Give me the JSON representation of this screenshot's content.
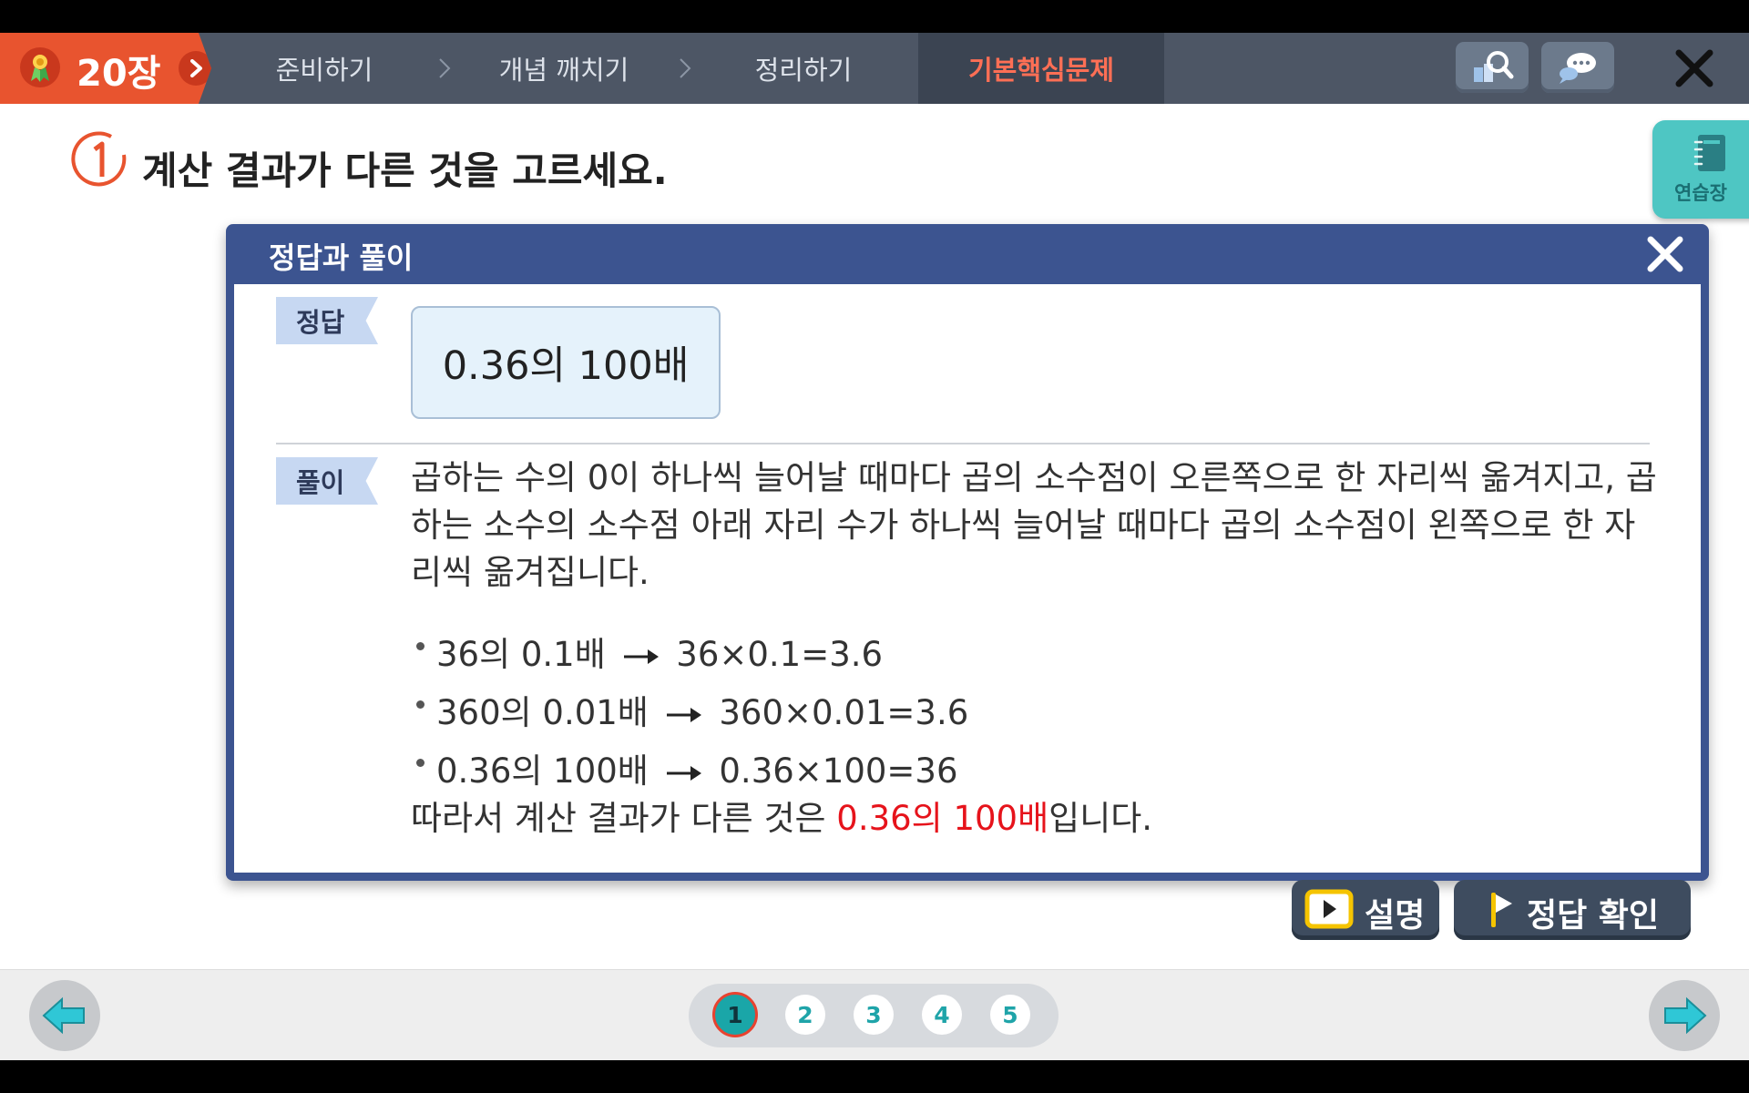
{
  "header": {
    "chapter": "20장",
    "steps": [
      {
        "label": "준비하기"
      },
      {
        "label": "개념 깨치기"
      },
      {
        "label": "정리하기"
      },
      {
        "label": "기본핵심문제"
      }
    ],
    "tools": [
      "search-book-icon",
      "chat-icon"
    ],
    "close_icon": "close-icon"
  },
  "question": {
    "number": "1",
    "text": "계산 결과가 다른 것을 고르세요."
  },
  "notebook": {
    "label": "연습장"
  },
  "modal": {
    "title": "정답과 풀이",
    "answer_tag": "정답",
    "answer": "0.36의 100배",
    "solution_tag": "풀이",
    "solution_text": "곱하는 수의 0이 하나씩 늘어날 때마다 곱의 소수점이 오른쪽으로 한 자리씩 옮겨지고, 곱하는 소수의 소수점 아래 자리 수가 하나씩 늘어날 때마다 곱의 소수점이 왼쪽으로 한 자리씩 옮겨집니다.",
    "items": [
      {
        "left": "36의 0.1배",
        "right": "36×0.1=3.6"
      },
      {
        "left": "360의 0.01배",
        "right": "360×0.01=3.6"
      },
      {
        "left": "0.36의 100배",
        "right": "0.36×100=36"
      }
    ],
    "conclusion_prefix": "따라서 계산 결과가 다른 것은 ",
    "conclusion_highlight": "0.36의 100배",
    "conclusion_suffix": "입니다."
  },
  "buttons": {
    "explain": "설명",
    "check": "정답 확인"
  },
  "pagination": {
    "pages": [
      "1",
      "2",
      "3",
      "4",
      "5"
    ],
    "current": "1"
  },
  "colors": {
    "accent_orange": "#e8542f",
    "modal_blue": "#3c5490",
    "highlight_red": "#e6131b",
    "teal": "#1aa6a8"
  }
}
